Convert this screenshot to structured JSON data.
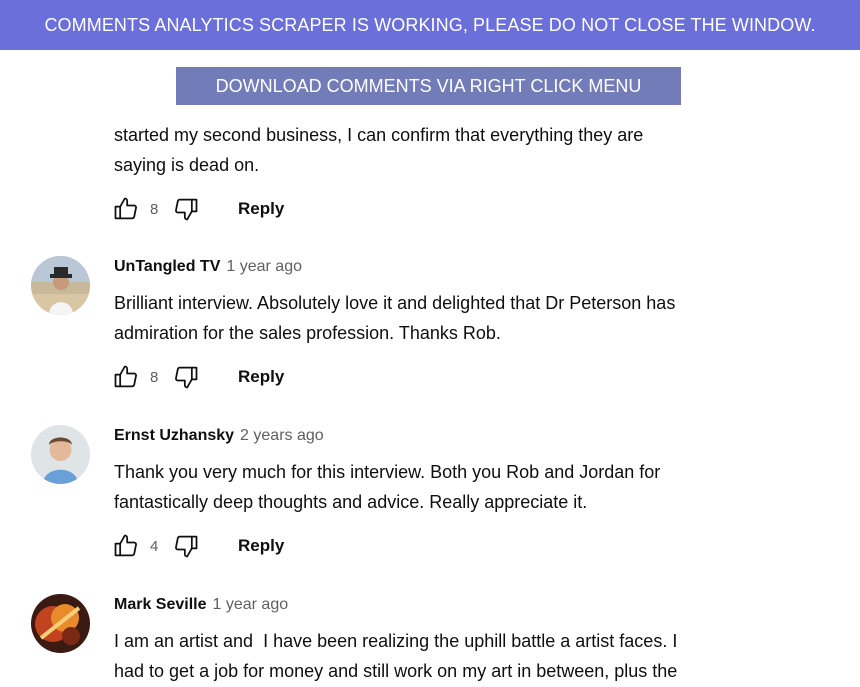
{
  "banner": {
    "text": "COMMENTS ANALYTICS SCRAPER IS WORKING, PLEASE DO NOT CLOSE THE WINDOW."
  },
  "download_button": {
    "label": "DOWNLOAD COMMENTS VIA RIGHT CLICK MENU"
  },
  "colors": {
    "banner_bg": "#6a6fd9",
    "button_bg": "#727cb8",
    "text_primary": "#0f0f0f",
    "text_secondary": "#606060"
  },
  "comments": [
    {
      "author": "",
      "time": "",
      "text": "started my second business, I can confirm that everything they are\nsaying is dead on.",
      "likes": "8",
      "reply_label": "Reply"
    },
    {
      "author": "UnTangled TV",
      "time": "1 year ago",
      "text": "Brilliant interview. Absolutely love it and delighted that Dr Peterson has\nadmiration for the sales profession. Thanks Rob.",
      "likes": "8",
      "reply_label": "Reply"
    },
    {
      "author": "Ernst Uzhansky",
      "time": "2 years ago",
      "text": "Thank you very much for this interview. Both you Rob and Jordan for\nfantastically deep thoughts and advice. Really appreciate it.",
      "likes": "4",
      "reply_label": "Reply"
    },
    {
      "author": "Mark Seville",
      "time": "1 year ago",
      "text": "I am an artist and  I have been realizing the uphill battle a artist faces. I\nhad to get a job for money and still work on my art in between, plus the",
      "likes": "",
      "reply_label": ""
    }
  ],
  "icons": {
    "like": "thumbs-up-icon",
    "dislike": "thumbs-down-icon"
  }
}
